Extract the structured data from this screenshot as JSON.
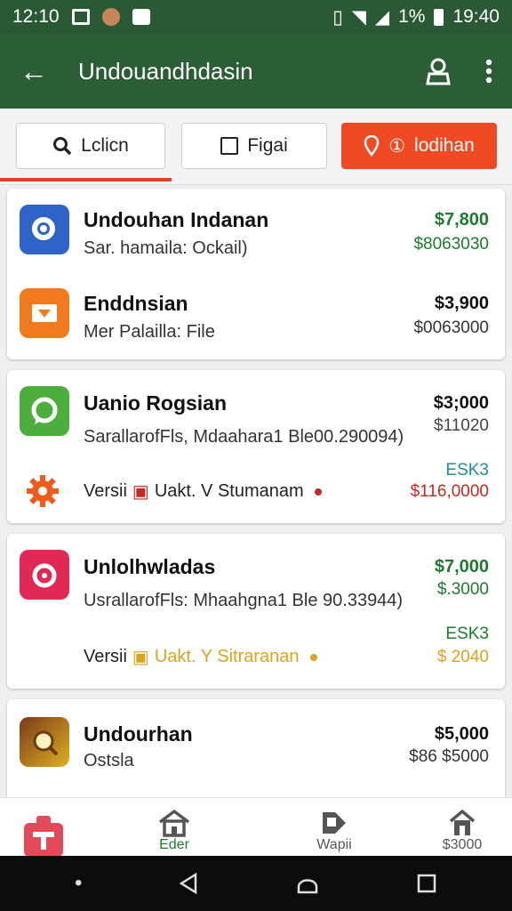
{
  "status": {
    "time": "12:10",
    "battery": "1%",
    "clock": "19:40"
  },
  "appbar": {
    "title": "Undouandhdasin"
  },
  "filters": {
    "chip1": {
      "label": "Lclicn",
      "icon": "search-icon"
    },
    "chip2": {
      "label": "Figai",
      "icon": "checkbox-icon"
    },
    "chip3": {
      "label": "lodihan",
      "icon": "location-icon",
      "prefix": "①"
    }
  },
  "cards": [
    {
      "rows": [
        {
          "name": "Undouhan Indanan",
          "sub": "Sar. hamaila: Ockail)",
          "price": "$7,800",
          "price2": "$8063030",
          "icon": "search-app-icon",
          "color": "#2e64c8",
          "price_color": "#1e7a2e",
          "price2_color": "#1e7a2e"
        },
        {
          "name": "Enddnsian",
          "sub": "Mer Palailla: File",
          "price": "$3,900",
          "price2": "$0063000",
          "icon": "folder-icon",
          "color": "#f07a1e",
          "price_color": "#111111",
          "price2_color": "#333333"
        }
      ]
    },
    {
      "name": "Uanio Rogsian",
      "sub": "SarallarofFls, Mdaahara1 Ble00.290094)",
      "price": "$3;000",
      "price2": "$11020",
      "tag": "ESK3",
      "version_label": "Versii",
      "status_text": "Uakt. V Stumanam",
      "status_price": "$116,0000",
      "icon": "chat-app-icon",
      "settings_icon": "gear-icon",
      "color": "#4cae3c",
      "price_color": "#111111",
      "tag_color": "#1a8f99",
      "status_color": "#c42a22"
    },
    {
      "name": "Unlolhwladas",
      "sub": "UsrallarofFls: Mhaahgna1 Ble 90.33944)",
      "price": "$7,000",
      "price2": "$.3000",
      "tag": "ESK3",
      "version_label": "Versii",
      "status_text": "Uakt. Y Sitraranan",
      "status_price": "$ 2040",
      "icon": "camera-app-icon",
      "color": "#e02a55",
      "price_color": "#1e7a2e",
      "tag_color": "#1e7a2e",
      "status_color": "#e0a21a"
    },
    {
      "name": "Undourhan",
      "sub": "Ostsla",
      "price": "$5,000",
      "price2": "$86 $5000",
      "icon": "photo-app-icon",
      "color": "#d6a21a",
      "price_color": "#111111"
    }
  ],
  "bottomnav": [
    {
      "label": "",
      "icon": "tag-icon"
    },
    {
      "label": "Eder",
      "icon": "home-icon"
    },
    {
      "label": "Wapii",
      "icon": "store-icon"
    },
    {
      "label": "$3000",
      "icon": "house-icon"
    }
  ],
  "colors": {
    "appbar": "#2b5e35",
    "accent": "#ef4a23"
  }
}
